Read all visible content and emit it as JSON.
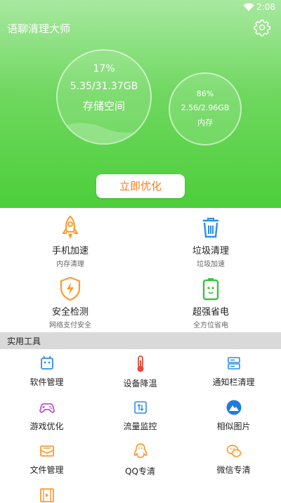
{
  "status_bar": {
    "time": "2:08"
  },
  "header": {
    "title": "语聊清理大师"
  },
  "storage": {
    "percent": "17%",
    "usage": "5.35/31.37GB",
    "label": "存储空间"
  },
  "memory": {
    "percent": "86%",
    "usage": "2.56/2.96GB",
    "label": "内存"
  },
  "optimize_label": "立即优化",
  "features": [
    {
      "title": "手机加速",
      "sub": "内存清理"
    },
    {
      "title": "垃圾清理",
      "sub": "垃圾加速"
    },
    {
      "title": "安全检测",
      "sub": "网络支付安全"
    },
    {
      "title": "超强省电",
      "sub": "全方位省电"
    }
  ],
  "tools_section": "实用工具",
  "tools": [
    {
      "label": "软件管理"
    },
    {
      "label": "设备降温"
    },
    {
      "label": "通知栏清理"
    },
    {
      "label": "游戏优化"
    },
    {
      "label": "流量监控"
    },
    {
      "label": "相似图片"
    },
    {
      "label": "文件管理"
    },
    {
      "label": "QQ专清"
    },
    {
      "label": "微信专清"
    }
  ],
  "colors": {
    "accent_green": "#4cce3a",
    "accent_orange": "#ff9a2e",
    "accent_blue": "#2e8ee8"
  }
}
